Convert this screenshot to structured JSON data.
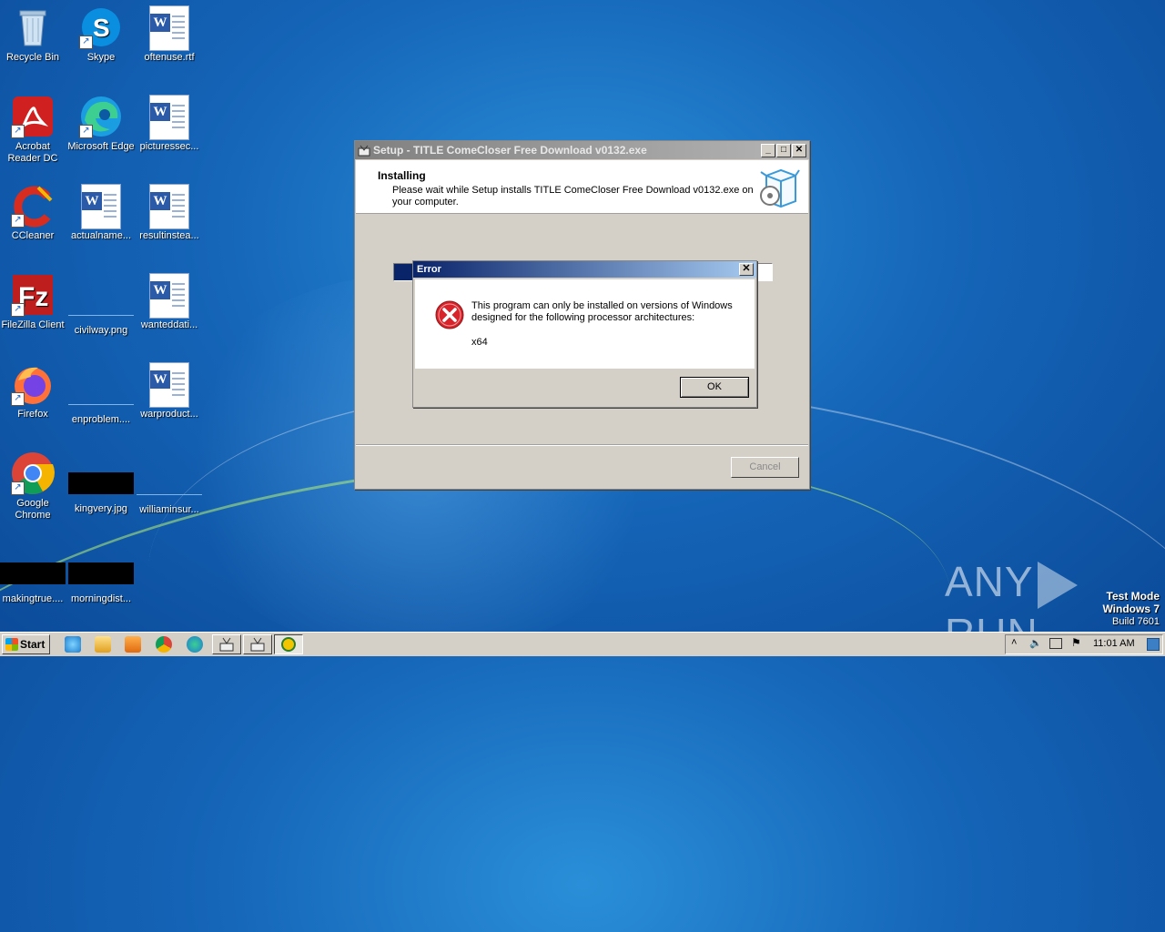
{
  "desktop": {
    "icons": [
      {
        "label": "Recycle Bin",
        "kind": "recycle-bin-icon"
      },
      {
        "label": "Skype",
        "kind": "skype-icon"
      },
      {
        "label": "oftenuse.rtf",
        "kind": "word-doc-icon"
      },
      {
        "label": "Acrobat Reader DC",
        "kind": "acrobat-icon"
      },
      {
        "label": "Microsoft Edge",
        "kind": "edge-icon"
      },
      {
        "label": "picturessec...",
        "kind": "word-doc-icon"
      },
      {
        "label": "CCleaner",
        "kind": "ccleaner-icon"
      },
      {
        "label": "actualname...",
        "kind": "word-doc-icon"
      },
      {
        "label": "resultinstea...",
        "kind": "word-doc-icon"
      },
      {
        "label": "FileZilla Client",
        "kind": "filezilla-icon"
      },
      {
        "label": "civilway.png",
        "kind": "image-thumb-icon"
      },
      {
        "label": "wanteddati...",
        "kind": "word-doc-icon"
      },
      {
        "label": "Firefox",
        "kind": "firefox-icon"
      },
      {
        "label": "enproblem....",
        "kind": "image-thumb-icon"
      },
      {
        "label": "warproduct...",
        "kind": "word-doc-icon"
      },
      {
        "label": "Google Chrome",
        "kind": "chrome-icon"
      },
      {
        "label": "kingvery.jpg",
        "kind": "image-thumb-icon"
      },
      {
        "label": "williaminsur...",
        "kind": "image-thumb-icon"
      },
      {
        "label": "makingtrue....",
        "kind": "image-thumb-icon"
      },
      {
        "label": "morningdist...",
        "kind": "image-thumb-icon"
      }
    ]
  },
  "setup_window": {
    "title": "Setup - TITLE ComeCloser Free Download v0132.exe",
    "header_title": "Installing",
    "header_subtitle": "Please wait while Setup installs TITLE ComeCloser Free Download v0132.exe on your computer.",
    "progress_fraction": 0.05,
    "cancel_label": "Cancel"
  },
  "error_dialog": {
    "title": "Error",
    "close_glyph": "✕",
    "message": "This program can only be installed on versions of Windows designed for the following processor architectures:",
    "architecture": "x64",
    "ok_label": "OK"
  },
  "watermark": {
    "left": "ANY",
    "right": "RUN"
  },
  "test_mode": {
    "line1": "Test Mode",
    "line2": "Windows 7",
    "line3": "Build 7601"
  },
  "taskbar": {
    "start_label": "Start",
    "clock": "11:01 AM"
  }
}
